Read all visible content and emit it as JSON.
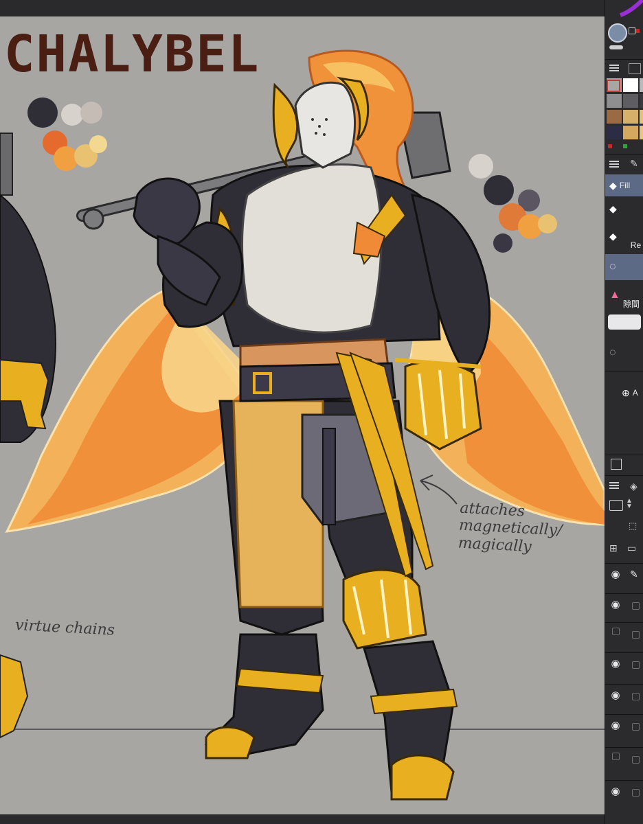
{
  "canvas": {
    "title": "CHALYBEL",
    "notes": {
      "attach": "attaches magnetically/ magically",
      "virtue": "virtue chains"
    },
    "palettes": {
      "left": [
        "#2f2e36",
        "#d8d2cc",
        "#c4bcb5",
        "#e46a2e",
        "#f0a040",
        "#e8c270",
        "#f2d890"
      ],
      "right": [
        "#d8d2cc",
        "#2f2e36",
        "#5a5560",
        "#e07a38",
        "#f0a040",
        "#e8c270",
        "#3a3644"
      ]
    },
    "colors": {
      "background": "#a8a6a3",
      "title": "#4a1e12",
      "armor_dark": "#2f2e36",
      "gold": "#e8b020",
      "wing_light": "#f0d080",
      "wing_orange": "#f07a30",
      "hair": "#f0923a",
      "cloth": "#e2ded8",
      "sash": "#d9955e",
      "skirt": "#e6b35a"
    }
  },
  "panel": {
    "fill_label": "Fill",
    "re_label": "Re",
    "cjk_label": "隙間",
    "add_label": "A",
    "colors": {
      "ring": "#9a2fd6",
      "selected": "#c23a3a",
      "dot_red": "#c7282b",
      "dot_green": "#2fa23a"
    },
    "color_grid": [
      "#a7a6a3",
      "#ffffff",
      "#b9b9bc",
      "#8e8d8f",
      "#5e5d61",
      "#3a3a3e",
      "#9a6a44",
      "#d6b06a",
      "#e3c27a",
      "#2c2c44",
      "#d4a85e",
      "#e8c484"
    ],
    "icons": [
      "brush-circle-icon",
      "fill-bucket-icon",
      "lasso-icon",
      "cake-icon",
      "layers-icon",
      "folder-add-icon",
      "eye-icon",
      "pencil-icon"
    ]
  }
}
